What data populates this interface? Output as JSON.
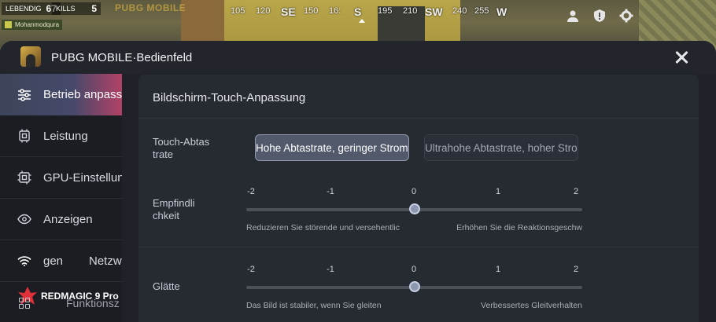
{
  "game_hud": {
    "stat_left_label": "LEBENDIG",
    "stat_left_value": "67",
    "stat_right_label": "KILLS",
    "stat_right_value": "5",
    "player_name": "Mohanmodqura",
    "logo_text": "PUBG MOBILE",
    "compass": [
      "105",
      "120",
      "SE",
      "150",
      "16:",
      "S",
      "195",
      "210",
      "SW",
      "240",
      "255",
      "W"
    ],
    "icons": [
      "person-icon",
      "shield-icon",
      "gear-icon"
    ]
  },
  "window": {
    "title": "PUBG MOBILE·Bedienfeld",
    "close_icon": "close-icon"
  },
  "sidebar": {
    "items": [
      {
        "label": "Betrieb anpass",
        "icon": "sliders-icon",
        "active": true
      },
      {
        "label": "Leistung",
        "icon": "cpu-chip-icon",
        "active": false
      },
      {
        "label": "GPU-Einstellun",
        "icon": "gpu-chip-icon",
        "active": false
      },
      {
        "label": "Anzeigen",
        "icon": "eye-icon",
        "active": false
      },
      {
        "label": "gen",
        "label2": "Netzw",
        "icon": "wifi-icon",
        "active": false
      }
    ],
    "brand": "REDMAGIC 9 Pro",
    "functions_label": "Funktionsz"
  },
  "content": {
    "title": "Bildschirm-Touch-Anpassung",
    "touch_sampling": {
      "label_line1": "Touch-Abtas",
      "label_line2": "trate",
      "options": [
        "Hohe Abtastrate, geringer Stromve",
        "Ultrahohe Abtastrate, hoher Stron"
      ],
      "selected_index": 0
    },
    "sensitivity": {
      "label_line1": "Empfindli",
      "label_line2": "chkeit",
      "ticks": [
        "-2",
        "-1",
        "0",
        "1",
        "2"
      ],
      "value": 0,
      "min": -2,
      "max": 2,
      "hint_left": "Reduzieren Sie störende und versehentlic",
      "hint_right": "Erhöhen Sie die Reaktionsgeschw"
    },
    "smoothness": {
      "label": "Glätte",
      "ticks": [
        "-2",
        "-1",
        "0",
        "1",
        "2"
      ],
      "value": 0,
      "min": -2,
      "max": 2,
      "hint_left": "Das Bild ist stabiler, wenn Sie gleiten",
      "hint_right": "Verbessertes Gleitverhalten"
    }
  },
  "colors": {
    "panel_bg": "#1f2228",
    "content_bg": "#262a31",
    "active_gradient_end": "#b24266",
    "accent_thumb": "#8d97b0"
  }
}
